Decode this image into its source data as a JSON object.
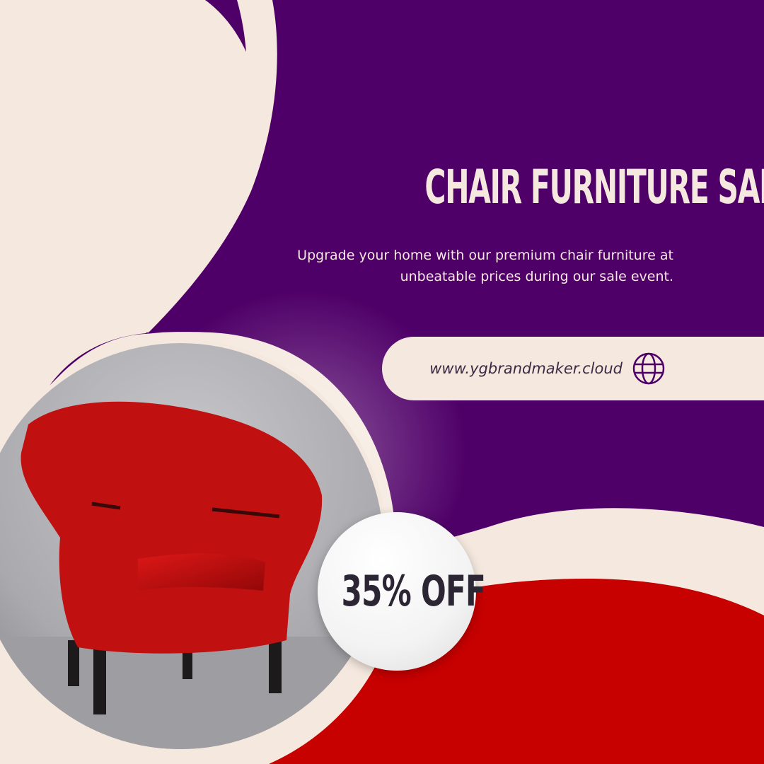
{
  "colors": {
    "cream": "#f5e9df",
    "purple": "#4f0068",
    "red": "#c70000",
    "text_light": "#f5e9df",
    "text_dark": "#2c2533",
    "url_text": "#3a2a44",
    "chair_red": "#c01010"
  },
  "headline": "CHAIR FURNITURE SALE",
  "subtitle_line1": "Upgrade your home with our premium chair furniture at",
  "subtitle_line2": "unbeatable prices during our sale event.",
  "website": "www.ygbrandmaker.cloud",
  "discount": "35% OFF",
  "icons": {
    "web": "globe-icon"
  }
}
